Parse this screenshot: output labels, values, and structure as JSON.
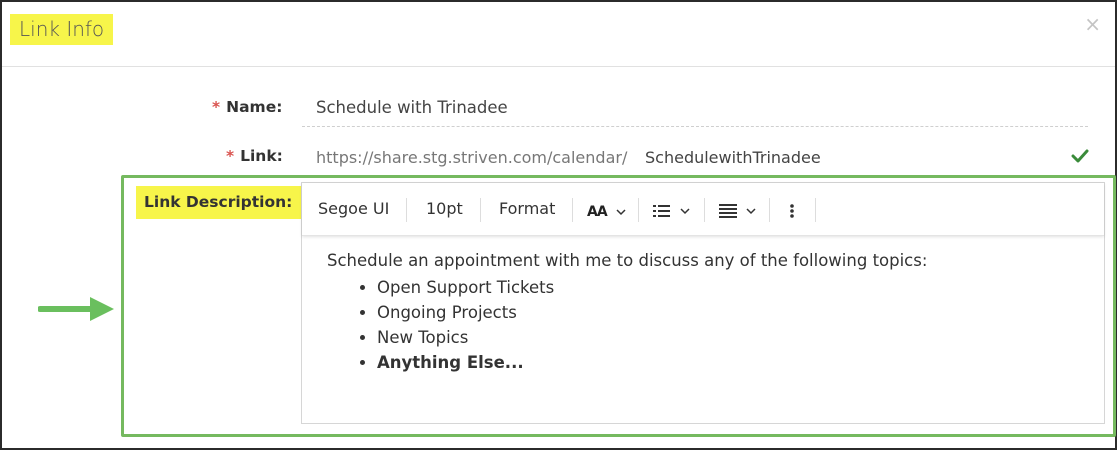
{
  "dialog": {
    "title": "Link Info",
    "close_label": "×"
  },
  "form": {
    "required_mark": "*",
    "name_label": "Name:",
    "name_value": "Schedule with Trinadee",
    "link_label": "Link:",
    "link_prefix": "https://share.stg.striven.com/calendar/",
    "link_slug": "SchedulewithTrinadee",
    "description_label": "Link Description:"
  },
  "toolbar": {
    "font_family": "Segoe UI",
    "font_size": "10pt",
    "format_label": "Format",
    "text_size_icon_label": "AA"
  },
  "editor": {
    "intro": "Schedule an appointment with me to discuss any of the following topics:",
    "items": [
      {
        "text": "Open Support Tickets",
        "bold": false
      },
      {
        "text": "Ongoing Projects",
        "bold": false
      },
      {
        "text": "New Topics",
        "bold": false
      },
      {
        "text": "Anything Else...",
        "bold": true
      }
    ]
  },
  "icons": {
    "close": "close-icon",
    "check": "check-icon",
    "arrow": "arrow-right-icon",
    "list": "bullet-list-icon",
    "align": "align-icon",
    "more": "more-vertical-icon",
    "chevron": "chevron-down-icon"
  },
  "colors": {
    "highlight_yellow": "#f7f54a",
    "required_red": "#d9534f",
    "accent_green": "#75b95f",
    "check_green": "#3a8b3a"
  }
}
